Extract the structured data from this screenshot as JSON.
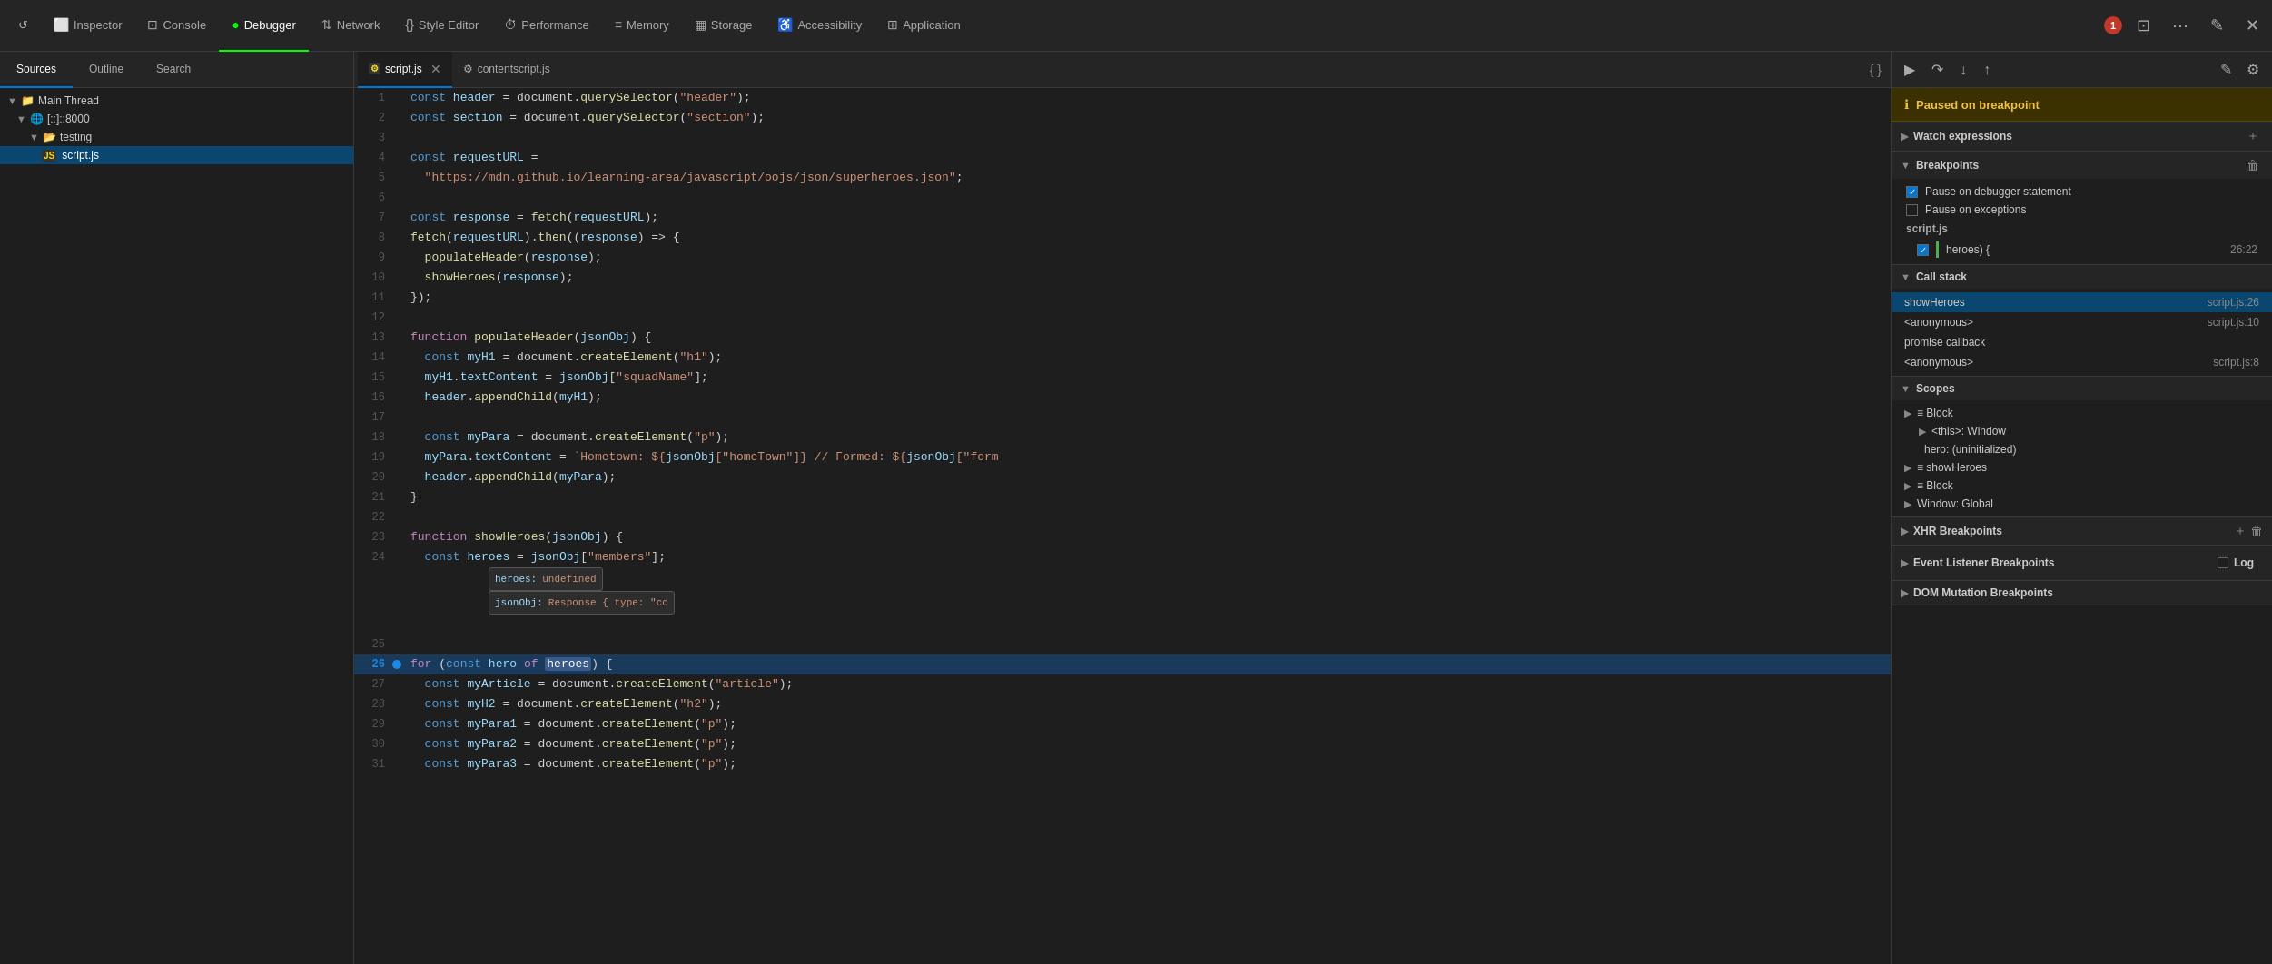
{
  "nav": {
    "items": [
      {
        "id": "inspector",
        "label": "Inspector",
        "icon": "⬜",
        "active": false
      },
      {
        "id": "console",
        "label": "Console",
        "icon": "⊡",
        "active": false
      },
      {
        "id": "debugger",
        "label": "Debugger",
        "icon": "◉",
        "active": true
      },
      {
        "id": "network",
        "label": "Network",
        "icon": "⇅",
        "active": false
      },
      {
        "id": "style-editor",
        "label": "Style Editor",
        "icon": "{}",
        "active": false
      },
      {
        "id": "performance",
        "label": "Performance",
        "icon": "⏱",
        "active": false
      },
      {
        "id": "memory",
        "label": "Memory",
        "icon": "≡",
        "active": false
      },
      {
        "id": "storage",
        "label": "Storage",
        "icon": "▦",
        "active": false
      },
      {
        "id": "accessibility",
        "label": "Accessibility",
        "icon": "♿",
        "active": false
      },
      {
        "id": "application",
        "label": "Application",
        "icon": "⊞",
        "active": false
      }
    ],
    "error_count": "1"
  },
  "left_panel": {
    "sub_tabs": [
      "Sources",
      "Outline",
      "Search"
    ],
    "active_tab": "Sources",
    "tree": {
      "items": [
        {
          "level": 0,
          "label": "Main Thread",
          "type": "thread",
          "expanded": true
        },
        {
          "level": 1,
          "label": "⊕ [::]::8000",
          "type": "host",
          "expanded": true
        },
        {
          "level": 2,
          "label": "testing",
          "type": "folder",
          "expanded": true
        },
        {
          "level": 3,
          "label": "script.js",
          "type": "js",
          "selected": true
        }
      ]
    }
  },
  "center_panel": {
    "tabs": [
      {
        "label": "script.js",
        "closable": true,
        "active": true
      },
      {
        "label": "contentscript.js",
        "closable": false,
        "active": false
      }
    ],
    "code_lines": [
      {
        "num": 1,
        "content": "const header = document.querySelector(\"header\");"
      },
      {
        "num": 2,
        "content": "const section = document.querySelector(\"section\");"
      },
      {
        "num": 3,
        "content": ""
      },
      {
        "num": 4,
        "content": "const requestURL ="
      },
      {
        "num": 5,
        "content": "  \"https://mdn.github.io/learning-area/javascript/oojs/json/superheroes.json\";"
      },
      {
        "num": 6,
        "content": ""
      },
      {
        "num": 7,
        "content": "const response = fetch(requestURL);"
      },
      {
        "num": 8,
        "content": "fetch(requestURL).then((response) => {"
      },
      {
        "num": 9,
        "content": "  populateHeader(response);"
      },
      {
        "num": 10,
        "content": "  showHeroes(response);"
      },
      {
        "num": 11,
        "content": "});"
      },
      {
        "num": 12,
        "content": ""
      },
      {
        "num": 13,
        "content": "function populateHeader(jsonObj) {"
      },
      {
        "num": 14,
        "content": "  const myH1 = document.createElement(\"h1\");"
      },
      {
        "num": 15,
        "content": "  myH1.textContent = jsonObj[\"squadName\"];"
      },
      {
        "num": 16,
        "content": "  header.appendChild(myH1);"
      },
      {
        "num": 17,
        "content": ""
      },
      {
        "num": 18,
        "content": "  const myPara = document.createElement(\"p\");"
      },
      {
        "num": 19,
        "content": "  myPara.textContent = `Hometown: ${jsonObj[\"homeTown\"]} // Formed: ${jsonObj[\"form"
      },
      {
        "num": 20,
        "content": "  header.appendChild(myPara);"
      },
      {
        "num": 21,
        "content": "}"
      },
      {
        "num": 22,
        "content": ""
      },
      {
        "num": 23,
        "content": "function showHeroes(jsonObj) {"
      },
      {
        "num": 24,
        "content": "  const heroes = jsonObj[\"members\"];",
        "tooltip": true
      },
      {
        "num": 25,
        "content": ""
      },
      {
        "num": 26,
        "content": "for (const hero of heroes) {",
        "current": true,
        "breakpoint": true
      },
      {
        "num": 27,
        "content": "  const myArticle = document.createElement(\"article\");"
      },
      {
        "num": 28,
        "content": "  const myH2 = document.createElement(\"h2\");"
      },
      {
        "num": 29,
        "content": "  const myPara1 = document.createElement(\"p\");"
      },
      {
        "num": 30,
        "content": "  const myPara2 = document.createElement(\"p\");"
      },
      {
        "num": 31,
        "content": "  const myPara3 = document.createElement(\"p\");"
      }
    ]
  },
  "right_panel": {
    "paused_text": "Paused on breakpoint",
    "sections": {
      "watch": {
        "label": "Watch expressions",
        "expanded": true
      },
      "breakpoints": {
        "label": "Breakpoints",
        "expanded": true,
        "options": [
          {
            "label": "Pause on debugger statement",
            "checked": true
          },
          {
            "label": "Pause on exceptions",
            "checked": false
          }
        ],
        "file": "script.js",
        "locations": [
          {
            "text": "heroes) {",
            "line": "26:22"
          }
        ]
      },
      "callstack": {
        "label": "Call stack",
        "expanded": true,
        "items": [
          {
            "name": "showHeroes",
            "file": "script.js:26",
            "active": true
          },
          {
            "name": "<anonymous>",
            "file": "script.js:10",
            "active": false
          },
          {
            "name": "promise callback",
            "file": "",
            "active": false
          },
          {
            "name": "<anonymous>",
            "file": "script.js:8",
            "active": false
          }
        ]
      },
      "scopes": {
        "label": "Scopes",
        "expanded": true,
        "items": [
          {
            "indent": 0,
            "arrow": "▶",
            "name": "≡ Block",
            "value": ""
          },
          {
            "indent": 1,
            "arrow": "▶",
            "name": "<this>: Window",
            "value": ""
          },
          {
            "indent": 1,
            "arrow": "",
            "name": "hero: (uninitialized)",
            "value": ""
          },
          {
            "indent": 0,
            "arrow": "▶",
            "name": "≡ showHeroes",
            "value": ""
          },
          {
            "indent": 0,
            "arrow": "▶",
            "name": "≡ Block",
            "value": ""
          },
          {
            "indent": 0,
            "arrow": "▶",
            "name": "Window: Global",
            "value": ""
          }
        ]
      },
      "xhr_breakpoints": {
        "label": "XHR Breakpoints",
        "expanded": false
      },
      "event_breakpoints": {
        "label": "Event Listener Breakpoints",
        "expanded": false,
        "log_label": "Log"
      },
      "dom_breakpoints": {
        "label": "DOM Mutation Breakpoints",
        "expanded": false
      }
    }
  }
}
